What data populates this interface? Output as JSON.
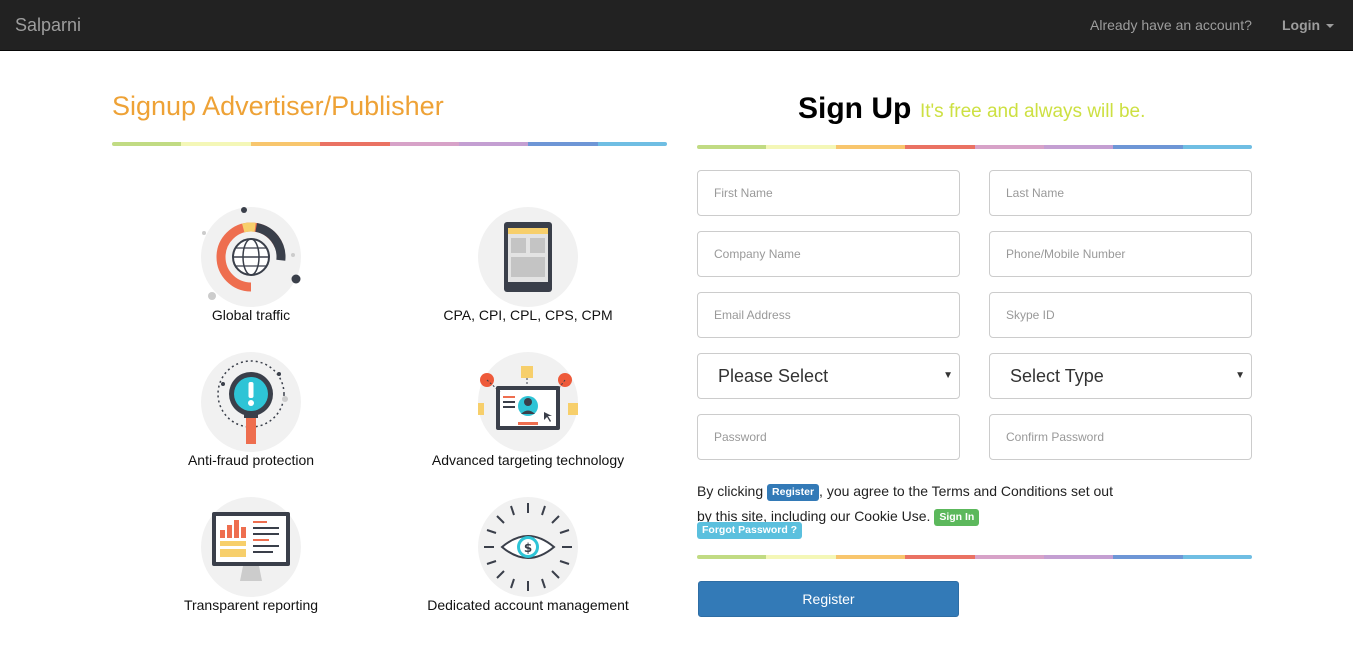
{
  "navbar": {
    "brand": "Salparni",
    "account_text": "Already have an account?",
    "login_label": "Login"
  },
  "left": {
    "title": "Signup Advertiser/Publisher",
    "features": [
      {
        "label": "Global traffic",
        "icon": "globe-chart-icon"
      },
      {
        "label": "CPA, CPI, CPL, CPS, CPM",
        "icon": "tablet-icon"
      },
      {
        "label": "Anti-fraud protection",
        "icon": "magnifier-alert-icon"
      },
      {
        "label": "Advanced targeting technology",
        "icon": "targeting-screen-icon"
      },
      {
        "label": "Transparent reporting",
        "icon": "monitor-report-icon"
      },
      {
        "label": "Dedicated account management",
        "icon": "dollar-eye-icon"
      }
    ]
  },
  "stripe_colors": [
    "#c1db83",
    "#f4f7b7",
    "#f8c66d",
    "#ea7263",
    "#d7a2c8",
    "#c49fd2",
    "#6e96d6",
    "#6fbee3"
  ],
  "form": {
    "title": "Sign Up",
    "subtitle": "It's free and always will be.",
    "first_name_placeholder": "First Name",
    "last_name_placeholder": "Last Name",
    "company_placeholder": "Company Name",
    "phone_placeholder": "Phone/Mobile Number",
    "email_placeholder": "Email Address",
    "skype_placeholder": "Skype ID",
    "country_select": "Please Select",
    "type_select": "Select Type",
    "password_placeholder": "Password",
    "confirm_password_placeholder": "Confirm Password",
    "terms_prefix": "By clicking",
    "terms_badge": "Register",
    "terms_middle": ", you agree to the Terms and Conditions set out by this site, including our Cookie Use.",
    "sign_in_label": "Sign In",
    "forgot_label": "Forgot Password ?",
    "register_button": "Register"
  }
}
